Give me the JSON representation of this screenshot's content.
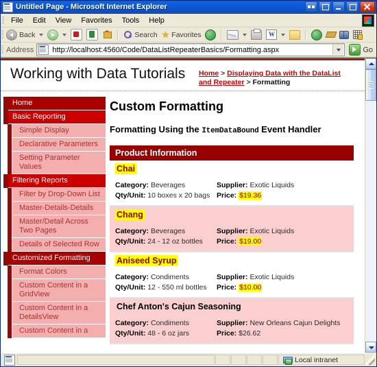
{
  "window": {
    "title": "Untitled Page - Microsoft Internet Explorer",
    "icon": "ie-page-icon",
    "buttons": {
      "restore_width": "restore-width-button",
      "restore_group": "restore-group-button",
      "minimize": "Minimize",
      "maximize": "Maximize",
      "close": "Close"
    }
  },
  "menu": {
    "items": [
      "File",
      "Edit",
      "View",
      "Favorites",
      "Tools",
      "Help"
    ]
  },
  "toolbar": {
    "back_label": "Back",
    "search_label": "Search",
    "favorites_label": "Favorites",
    "icons": [
      "back-icon",
      "back-dropdown-icon",
      "forward-icon",
      "forward-dropdown-icon",
      "stop-icon",
      "refresh-icon",
      "home-icon",
      "search-icon",
      "favorites-star-icon",
      "history-icon",
      "mail-icon",
      "mail-dropdown-icon",
      "print-icon",
      "edit-word-icon",
      "edit-dropdown-icon",
      "notes-icon",
      "messenger-icon",
      "discuss-icon",
      "research-icon",
      "encarta-icon"
    ]
  },
  "address": {
    "label": "Address",
    "url": "http://localhost:4560/Code/DataListRepeaterBasics/Formatting.aspx",
    "placeholder": "",
    "go_label": "Go"
  },
  "site": {
    "title": "Working with Data Tutorials",
    "breadcrumb": {
      "home": "Home",
      "sep1": " > ",
      "section": "Displaying Data with the DataList and Repeater",
      "sep2": " > ",
      "current": "Formatting"
    }
  },
  "sidebar": {
    "groups": [
      {
        "type": "section",
        "label": "Home",
        "style": "dark"
      },
      {
        "type": "section",
        "label": "Basic Reporting",
        "style": "bright",
        "items": [
          "Simple Display",
          "Declarative Parameters",
          "Setting Parameter Values"
        ]
      },
      {
        "type": "section",
        "label": "Filtering Reports",
        "style": "bright",
        "items": [
          "Filter by Drop-Down List",
          "Master-Details-Details",
          "Master/Detail Across Two Pages",
          "Details of Selected Row"
        ]
      },
      {
        "type": "section",
        "label": "Customized Formatting",
        "style": "dark",
        "items": [
          "Format Colors",
          "Custom Content in a GridView",
          "Custom Content in a DetailsView",
          "Custom Content in a"
        ]
      }
    ]
  },
  "main": {
    "page_title": "Custom Formatting",
    "sub_title_pre": "Formatting Using the ",
    "sub_title_code": "ItemDataBound",
    "sub_title_post": " Event Handler",
    "datalist_header": "Product Information",
    "labels": {
      "category": "Category:",
      "supplier": "Supplier:",
      "qty": "Qty/Unit:",
      "price": "Price:"
    },
    "products": [
      {
        "name": "Chai",
        "name_highlighted": true,
        "alt_row": false,
        "category": "Beverages",
        "supplier": "Exotic Liquids",
        "qty": "10 boxes x 20 bags",
        "price": "$19.36",
        "price_highlighted": true
      },
      {
        "name": "Chang",
        "name_highlighted": true,
        "alt_row": true,
        "category": "Beverages",
        "supplier": "Exotic Liquids",
        "qty": "24 - 12 oz bottles",
        "price": "$19.00",
        "price_highlighted": true
      },
      {
        "name": "Aniseed Syrup",
        "name_highlighted": true,
        "alt_row": false,
        "category": "Condiments",
        "supplier": "Exotic Liquids",
        "qty": "12 - 550 ml bottles",
        "price": "$10.00",
        "price_highlighted": true
      },
      {
        "name": "Chef Anton's Cajun Seasoning",
        "name_highlighted": false,
        "alt_row": true,
        "category": "Condiments",
        "supplier": "New Orleans Cajun Delights",
        "qty": "48 - 6 oz jars",
        "price": "$26.62",
        "price_highlighted": false
      }
    ]
  },
  "statusbar": {
    "text": "",
    "zone": "Local intranet",
    "zone_icon": "local-intranet-icon"
  },
  "colors": {
    "accent_red": "#cc0000",
    "dark_red": "#990000",
    "stripe_red": "#8b0d0d",
    "pink": "#f5aeae",
    "alt_row_pink": "#fbcfcf",
    "highlight_yellow": "#ffff00",
    "title_blue": "#0c5ad6"
  }
}
